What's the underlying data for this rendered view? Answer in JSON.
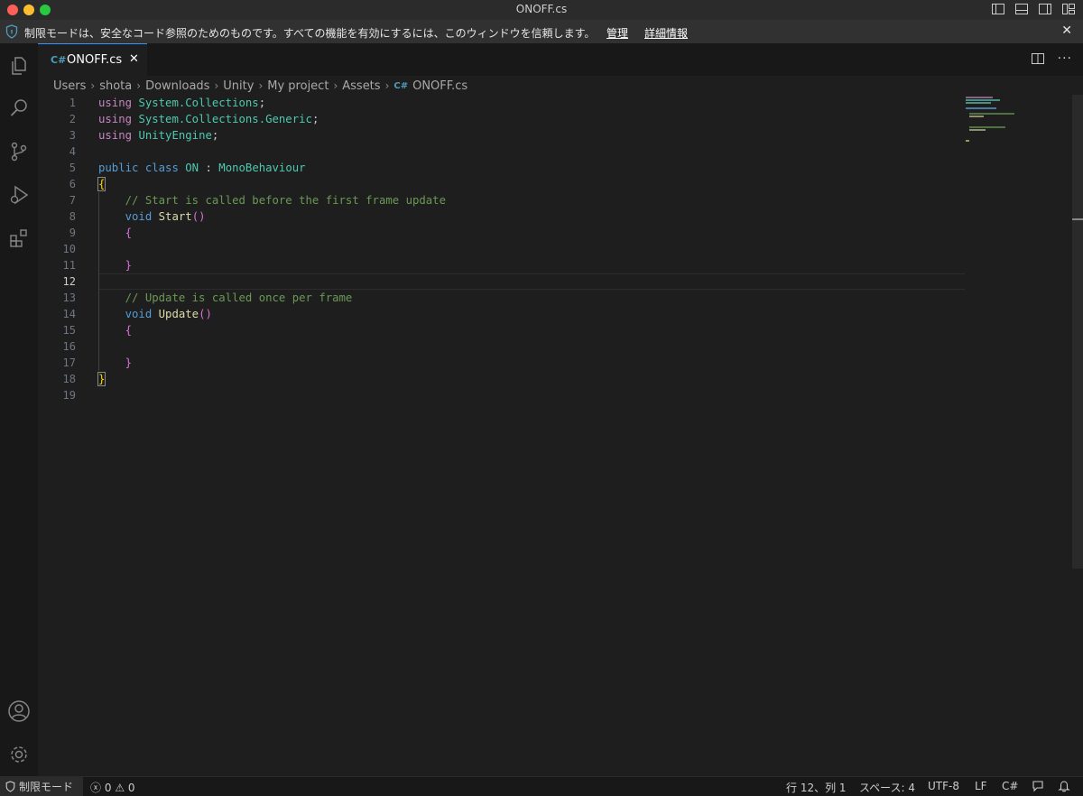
{
  "window": {
    "title": "ONOFF.cs"
  },
  "banner": {
    "message": "制限モードは、安全なコード参照のためのものです。すべての機能を有効にするには、このウィンドウを信頼します。",
    "manage_link": "管理",
    "details_link": "詳細情報"
  },
  "tab": {
    "label": "ONOFF.cs",
    "icon_text": "C#"
  },
  "breadcrumb": [
    "Users",
    "shota",
    "Downloads",
    "Unity",
    "My project",
    "Assets",
    "ONOFF.cs"
  ],
  "editor": {
    "line_numbers": [
      "1",
      "2",
      "3",
      "4",
      "5",
      "6",
      "7",
      "8",
      "9",
      "10",
      "11",
      "12",
      "13",
      "14",
      "15",
      "16",
      "17",
      "18",
      "19"
    ],
    "current_line": "12",
    "code": {
      "l1_kw": "using",
      "l1_ns": "System.Collections",
      "l2_kw": "using",
      "l2_ns": "System.Collections.Generic",
      "l3_kw": "using",
      "l3_ns": "UnityEngine",
      "l5_kw1": "public",
      "l5_kw2": "class",
      "l5_name": "ON",
      "l5_colon": ":",
      "l5_base": "MonoBehaviour",
      "l6": "{",
      "l7": "// Start is called before the first frame update",
      "l8_kw": "void",
      "l8_fn": "Start",
      "l9": "{",
      "l11": "}",
      "l13": "// Update is called once per frame",
      "l14_kw": "void",
      "l14_fn": "Update",
      "l15": "{",
      "l17": "}",
      "l18": "}"
    }
  },
  "statusbar": {
    "restricted_mode": "制限モード",
    "errors": "0",
    "warnings": "0",
    "position": "行 12、列 1",
    "spaces": "スペース: 4",
    "encoding": "UTF-8",
    "eol": "LF",
    "language": "C#"
  },
  "colors": {
    "accent": "#3794ff",
    "keyword": "#c586c0",
    "type": "#4ec9b0",
    "function": "#dcdcaa",
    "comment": "#6a9955"
  }
}
